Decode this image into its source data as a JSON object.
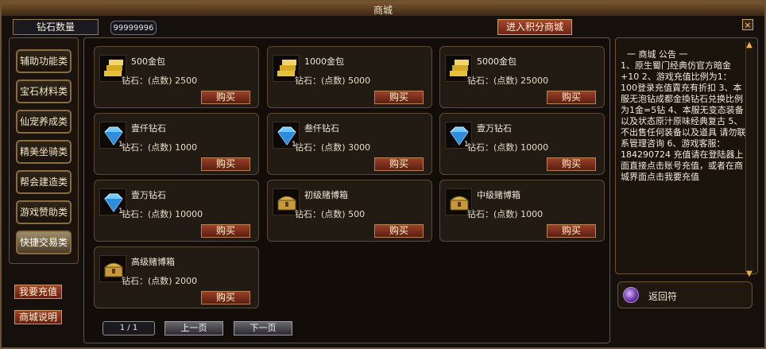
{
  "window": {
    "title": "商城",
    "close_icon": "×"
  },
  "header": {
    "currency_label": "钻石数量",
    "currency_value": "99999996",
    "enter_points_mall": "进入积分商城"
  },
  "sidebar": {
    "categories": [
      {
        "label": "辅助功能类",
        "active": false
      },
      {
        "label": "宝石材料类",
        "active": false
      },
      {
        "label": "仙宠养成类",
        "active": false
      },
      {
        "label": "精美坐骑类",
        "active": false
      },
      {
        "label": "帮会建造类",
        "active": false
      },
      {
        "label": "游戏赞助类",
        "active": false
      },
      {
        "label": "快捷交易类",
        "active": true
      }
    ],
    "recharge_button": "我要充值",
    "help_button": "商城说明"
  },
  "items": [
    {
      "name": "500金包",
      "price": "钻石：(点数) 2500",
      "buy": "购买",
      "icon": "gold-bars-icon"
    },
    {
      "name": "1000金包",
      "price": "钻石：(点数) 5000",
      "buy": "购买",
      "icon": "gold-bars-icon"
    },
    {
      "name": "5000金包",
      "price": "钻石：(点数) 25000",
      "buy": "购买",
      "icon": "gold-bars-icon"
    },
    {
      "name": "壹仟钻石",
      "price": "钻石：(点数) 1000",
      "buy": "购买",
      "icon": "diamond-icon",
      "qty": "1"
    },
    {
      "name": "叁仟钻石",
      "price": "钻石：(点数) 3000",
      "buy": "购买",
      "icon": "diamond-icon",
      "qty": "1"
    },
    {
      "name": "壹万钻石",
      "price": "钻石：(点数) 10000",
      "buy": "购买",
      "icon": "diamond-icon",
      "qty": "1"
    },
    {
      "name": "壹万钻石",
      "price": "钻石：(点数) 10000",
      "buy": "购买",
      "icon": "diamond-icon",
      "qty": "1"
    },
    {
      "name": "初级赌博箱",
      "price": "钻石：(点数) 500",
      "buy": "购买",
      "icon": "treasure-chest-icon"
    },
    {
      "name": "中级赌博箱",
      "price": "钻石：(点数) 1000",
      "buy": "购买",
      "icon": "treasure-chest-icon"
    },
    {
      "name": "高级赌博箱",
      "price": "钻石：(点数) 2000",
      "buy": "购买",
      "icon": "treasure-chest-icon"
    }
  ],
  "pagination": {
    "page_label": "1 / 1",
    "prev": "上一页",
    "next": "下一页"
  },
  "notice": {
    "title": "一 商城 公告 一",
    "body": "1、原生蜀门经典仿官方暗金+10 2、游戏充值比例为1：100登录充值賣充有折扣 3、本服无泡钻成都金換钻石兑换比例为1金=5钻 4、本服无变态装备以及状态原汁原味经典复古 5、不出售任何装备以及道具 请勿联系管理咨询 6、游戏客服：184290724 充值请在登陆器上面直接点击账号充值，或者在商城界面点击我要充值"
  },
  "return_item": {
    "label": "返回符",
    "icon": "return-talisman-icon"
  },
  "scroll": {
    "up_icon": "▲",
    "down_icon": "▼"
  }
}
